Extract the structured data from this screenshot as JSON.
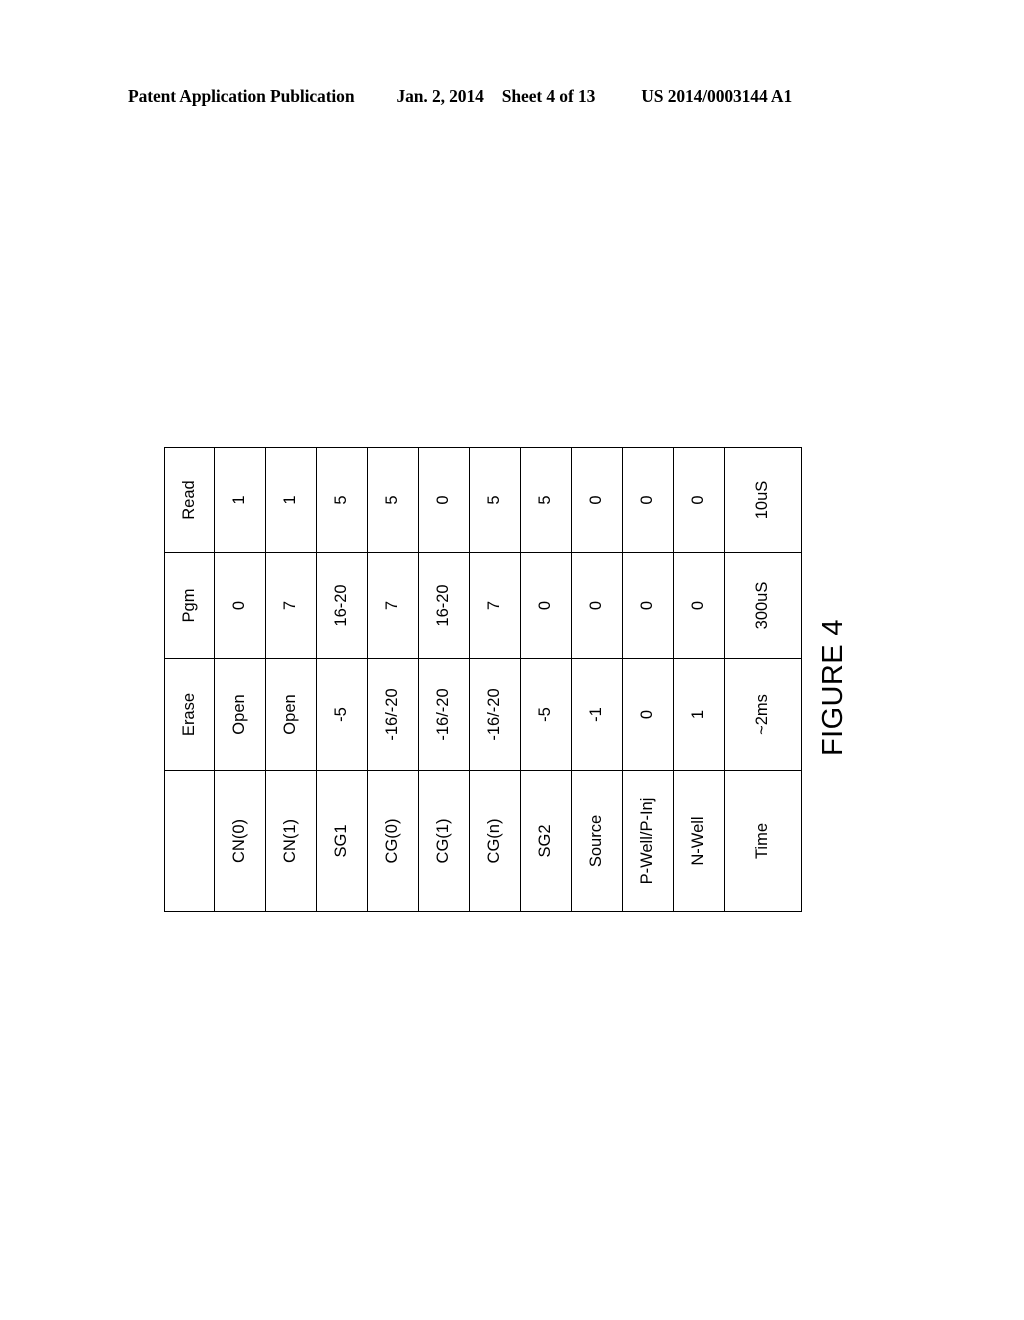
{
  "header": {
    "publication": "Patent Application Publication",
    "date": "Jan. 2, 2014",
    "sheet": "Sheet 4 of 13",
    "publication_number": "US 2014/0003144 A1"
  },
  "figure": {
    "caption": "FIGURE 4"
  },
  "table": {
    "corner_label": "",
    "columns": [
      "",
      "Erase",
      "Pgm",
      "Read"
    ],
    "rows": [
      {
        "label": "CN(0)",
        "erase": "Open",
        "pgm": "0",
        "read": "1"
      },
      {
        "label": "CN(1)",
        "erase": "Open",
        "pgm": "7",
        "read": "1"
      },
      {
        "label": "SG1",
        "erase": "-5",
        "pgm": "16-20",
        "read": "5"
      },
      {
        "label": "CG(0)",
        "erase": "-16/-20",
        "pgm": "7",
        "read": "5"
      },
      {
        "label": "CG(1)",
        "erase": "-16/-20",
        "pgm": "16-20",
        "read": "0"
      },
      {
        "label": "CG(n)",
        "erase": "-16/-20",
        "pgm": "7",
        "read": "5"
      },
      {
        "label": "SG2",
        "erase": "-5",
        "pgm": "0",
        "read": "5"
      },
      {
        "label": "Source",
        "erase": "-1",
        "pgm": "0",
        "read": "0"
      },
      {
        "label": "P-Well/P-Inj",
        "erase": "0",
        "pgm": "0",
        "read": "0"
      },
      {
        "label": "N-Well",
        "erase": "1",
        "pgm": "0",
        "read": "0"
      },
      {
        "label": "Time",
        "erase": "~2ms",
        "pgm": "300uS",
        "read": "10uS"
      }
    ]
  },
  "colors": {
    "page_background": "#ffffff",
    "ink": "#000000",
    "rule": "#000000"
  }
}
